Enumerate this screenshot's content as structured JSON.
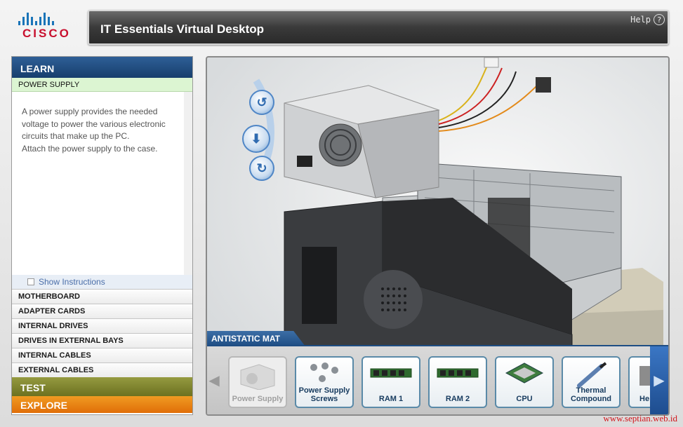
{
  "brand": {
    "logo_text": "CISCO"
  },
  "header": {
    "title": "IT Essentials Virtual Desktop",
    "help_label": "Help",
    "help_icon": "?"
  },
  "sidebar": {
    "learn_label": "LEARN",
    "active_item": "POWER SUPPLY",
    "description": [
      "A power supply provides the needed",
      "voltage to power the various electronic",
      "circuits that make up the PC.",
      "Attach the power supply to the case."
    ],
    "show_instructions": "Show Instructions",
    "items": [
      {
        "label": "MOTHERBOARD"
      },
      {
        "label": "ADAPTER CARDS"
      },
      {
        "label": "INTERNAL DRIVES"
      },
      {
        "label": "DRIVES IN EXTERNAL BAYS"
      },
      {
        "label": "INTERNAL CABLES"
      },
      {
        "label": "EXTERNAL CABLES"
      }
    ],
    "test_label": "TEST",
    "explore_label": "EXPLORE"
  },
  "viewport": {
    "mat_label": "ANTISTATIC MAT",
    "tray_items": [
      {
        "label": "Power Supply",
        "icon": "power-supply-icon",
        "enabled": false
      },
      {
        "label": "Power Supply Screws",
        "icon": "screws-icon",
        "enabled": true
      },
      {
        "label": "RAM 1",
        "icon": "ram-icon",
        "enabled": true
      },
      {
        "label": "RAM 2",
        "icon": "ram-icon",
        "enabled": true
      },
      {
        "label": "CPU",
        "icon": "cpu-icon",
        "enabled": true
      },
      {
        "label": "Thermal Compound",
        "icon": "thermal-compound-icon",
        "enabled": true
      },
      {
        "label": "He",
        "icon": "heatsink-icon",
        "enabled": true
      }
    ]
  },
  "watermark": "www.septian.web.id",
  "colors": {
    "learn": "#1f4c80",
    "test": "#7d8228",
    "explore": "#ea7d12",
    "active_item_bg": "#dcf5d2"
  }
}
